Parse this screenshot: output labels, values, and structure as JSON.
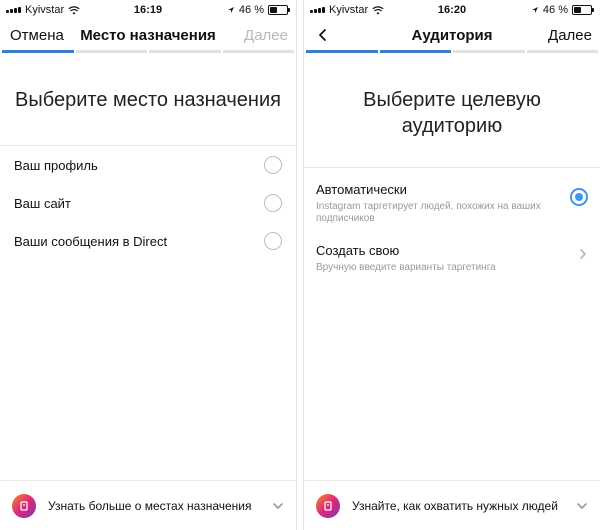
{
  "left": {
    "status": {
      "carrier": "Kyivstar",
      "time": "16:19",
      "battery": "46 %"
    },
    "nav": {
      "cancel": "Отмена",
      "title": "Место назначения",
      "next": "Далее"
    },
    "heading": "Выберите место назначения",
    "options": [
      {
        "label": "Ваш профиль"
      },
      {
        "label": "Ваш сайт"
      },
      {
        "label": "Ваши сообщения в Direct"
      }
    ],
    "bottom": {
      "text": "Узнать больше о местах назначения"
    }
  },
  "right": {
    "status": {
      "carrier": "Kyivstar",
      "time": "16:20",
      "battery": "46 %"
    },
    "nav": {
      "title": "Аудитория",
      "next": "Далее"
    },
    "heading": "Выберите целевую аудиторию",
    "options": {
      "auto": {
        "title": "Автоматически",
        "subtitle": "Instagram таргетирует людей, похожих на ваших подписчиков"
      },
      "custom": {
        "title": "Создать свою",
        "subtitle": "Вручную введите варианты таргетинга"
      }
    },
    "bottom": {
      "text": "Узнайте, как охватить нужных людей"
    }
  },
  "colors": {
    "accent": "#3e95f0",
    "progress": "#3e7cc7"
  },
  "icons": [
    "signal-icon",
    "wifi-icon",
    "location-icon",
    "battery-icon",
    "radio-icon",
    "chevron-right-icon",
    "chevron-down-icon",
    "info-icon"
  ]
}
